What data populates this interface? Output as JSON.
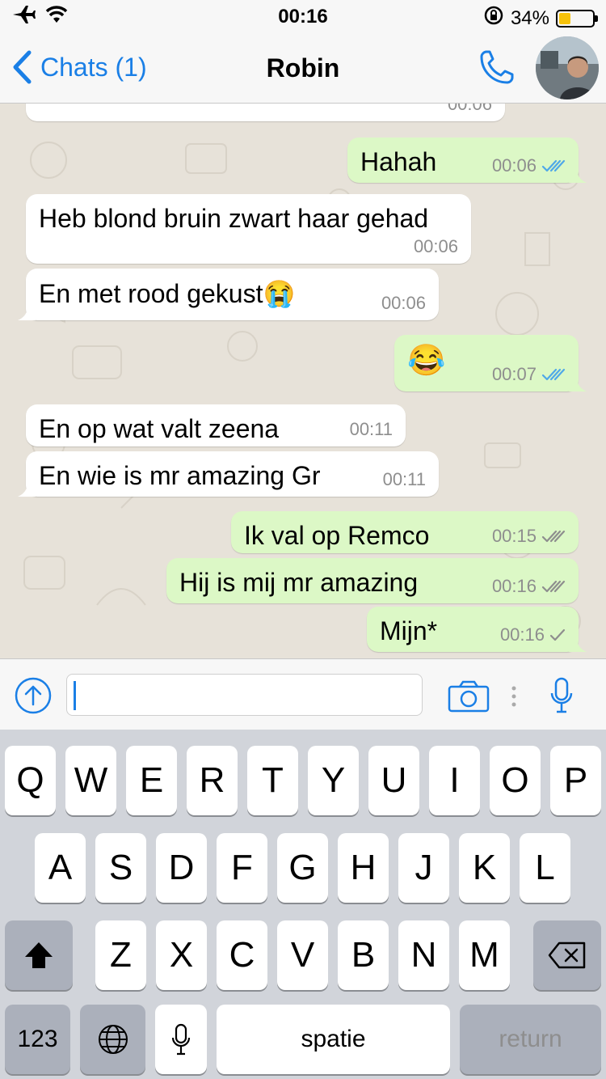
{
  "status_bar": {
    "time": "00:16",
    "battery": "34%",
    "battery_level": 0.34,
    "icons": [
      "airplane-icon",
      "wifi-icon",
      "orientation-lock-icon",
      "battery-icon"
    ]
  },
  "nav": {
    "back_label": "Chats (1)",
    "title": "Robin",
    "accent": "#1a7fe6"
  },
  "messages": [
    {
      "dir": "in",
      "text": "",
      "time": "00:06"
    },
    {
      "dir": "out",
      "text": "Hahah",
      "time": "00:06",
      "status": "read"
    },
    {
      "dir": "in",
      "text": "Heb blond bruin zwart haar gehad",
      "time": "00:06"
    },
    {
      "dir": "in",
      "text": "En met rood gekust😭",
      "time": "00:06"
    },
    {
      "dir": "out",
      "text": "😂",
      "time": "00:07",
      "status": "read"
    },
    {
      "dir": "in",
      "text": "En op wat valt zeena",
      "time": "00:11"
    },
    {
      "dir": "in",
      "text": "En wie is mr amazing Gr",
      "time": "00:11"
    },
    {
      "dir": "out",
      "text": "Ik val op Remco",
      "time": "00:15",
      "status": "delivered"
    },
    {
      "dir": "out",
      "text": "Hij is mij mr amazing",
      "time": "00:16",
      "status": "delivered"
    },
    {
      "dir": "out",
      "text": "Mijn*",
      "time": "00:16",
      "status": "sent"
    }
  ],
  "colors": {
    "incoming_bubble": "#ffffff",
    "outgoing_bubble": "#dcf8c6",
    "read_ticks": "#4fa8e8",
    "grey_ticks": "#8e8e8e",
    "chat_background": "#e7e2d9"
  },
  "input": {
    "value": ""
  },
  "keyboard": {
    "row1": [
      "Q",
      "W",
      "E",
      "R",
      "T",
      "Y",
      "U",
      "I",
      "O",
      "P"
    ],
    "row2": [
      "A",
      "S",
      "D",
      "F",
      "G",
      "H",
      "J",
      "K",
      "L"
    ],
    "row3": [
      "Z",
      "X",
      "C",
      "V",
      "B",
      "N",
      "M"
    ],
    "numbers_label": "123",
    "space_label": "spatie",
    "return_label": "return"
  }
}
